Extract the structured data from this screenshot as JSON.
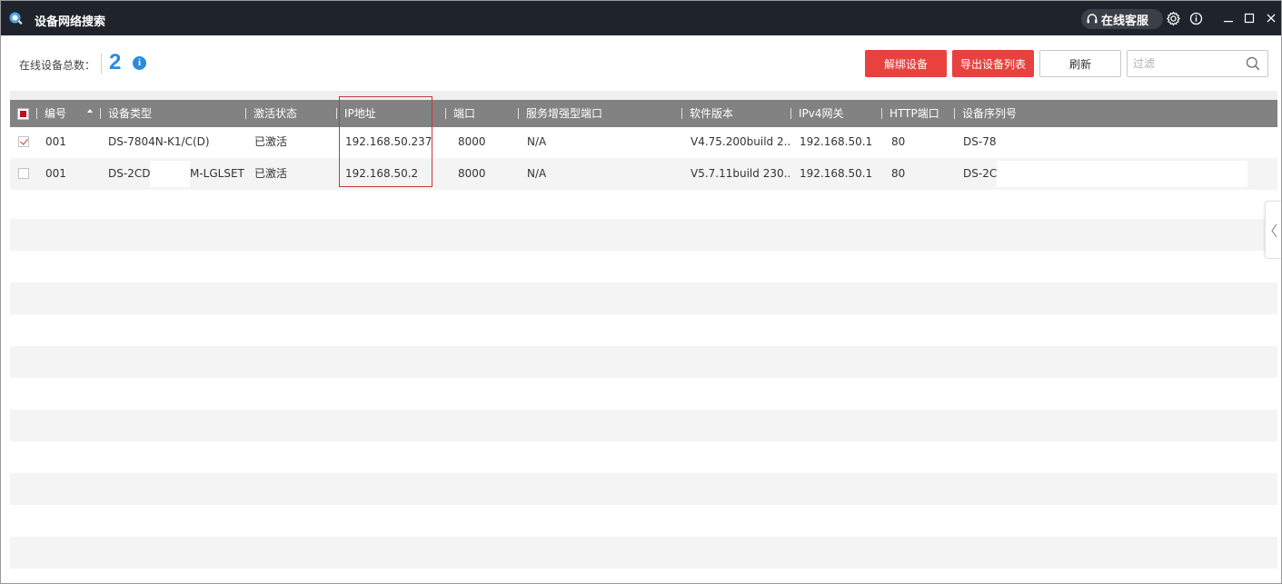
{
  "window": {
    "title": "设备网络搜索",
    "support_label": "在线客服",
    "icons": [
      "app-logo-icon",
      "headset-icon",
      "gear-icon",
      "info-icon",
      "minimize-icon",
      "maximize-icon",
      "close-icon"
    ]
  },
  "summary": {
    "label": "在线设备总数：",
    "count": "2"
  },
  "toolbar": {
    "unbind_label": "解绑设备",
    "export_label": "导出设备列表",
    "refresh_label": "刷新",
    "filter_placeholder": "过滤",
    "accent_color": "#e8413e"
  },
  "table": {
    "columns": [
      "编号",
      "设备类型",
      "激活状态",
      "IP地址",
      "端口",
      "服务增强型端口",
      "软件版本",
      "IPv4网关",
      "HTTP端口",
      "设备序列号"
    ],
    "header_checkbox_checked": true,
    "rows": [
      {
        "checked": true,
        "id": "001",
        "type": "DS-7804N-K1/C(D)",
        "status": "已激活",
        "ip": "192.168.50.237",
        "port": "8000",
        "enhanced_port": "N/A",
        "version": "V4.75.200build 2...",
        "gateway": "192.168.50.1",
        "http_port": "80",
        "serial": "DS-78"
      },
      {
        "checked": false,
        "id": "001",
        "type": "DS-2CD",
        "type_suffix": "M-LGLSET",
        "status": "已激活",
        "ip": "192.168.50.2",
        "port": "8000",
        "enhanced_port": "N/A",
        "version": "V5.7.11build 230...",
        "gateway": "192.168.50.1",
        "http_port": "80",
        "serial": "DS-2C"
      }
    ]
  }
}
